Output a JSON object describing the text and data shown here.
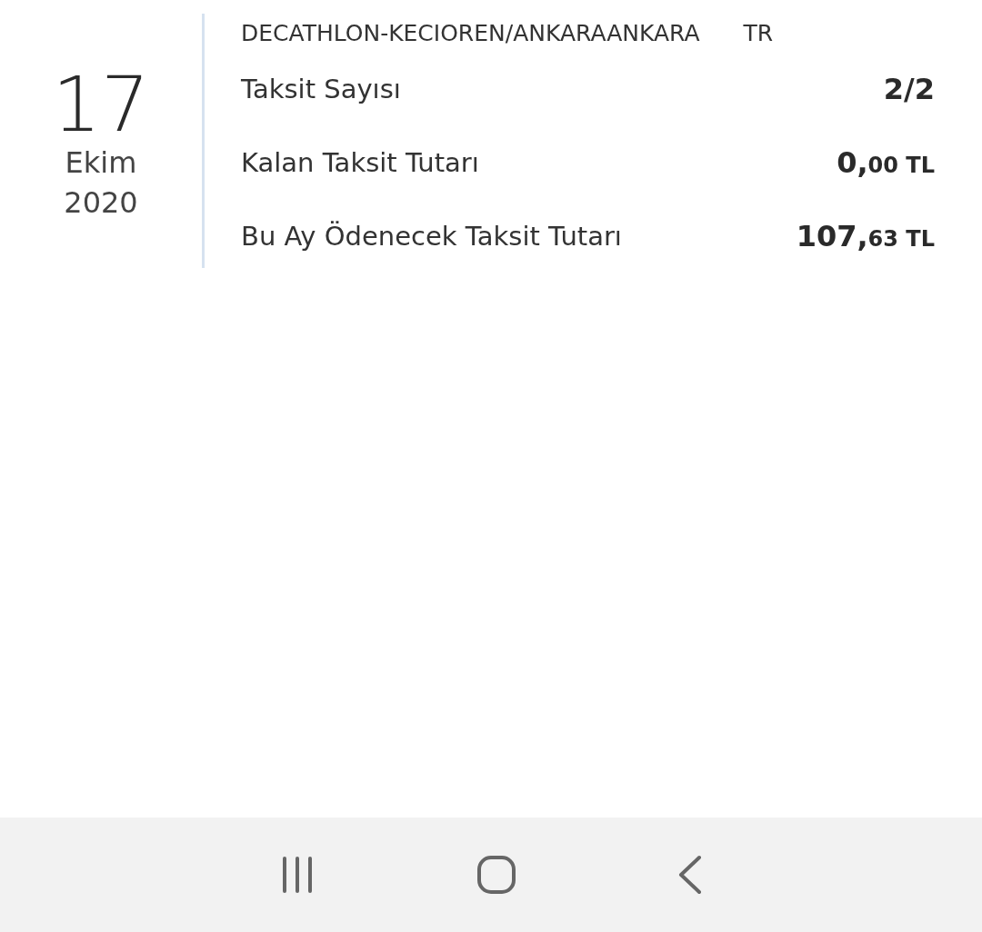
{
  "date": {
    "day": "17",
    "month": "Ekim",
    "year": "2020"
  },
  "merchant": {
    "name": "DECATHLON-KECIOREN/ANKARAANKARA",
    "country": "TR"
  },
  "rows": [
    {
      "kind": "count",
      "label": "Taksit Sayısı",
      "value": "2/2"
    },
    {
      "kind": "amount",
      "label": "Kalan Taksit Tutarı",
      "whole": "0,",
      "fraction": "00",
      "currency": "TL"
    },
    {
      "kind": "amount",
      "label": "Bu Ay Ödenecek Taksit Tutarı",
      "whole": "107,",
      "fraction": "63",
      "currency": "TL"
    }
  ],
  "nav_bar": {
    "buttons": [
      {
        "kind": "recents"
      },
      {
        "kind": "home"
      },
      {
        "kind": "back"
      }
    ]
  }
}
